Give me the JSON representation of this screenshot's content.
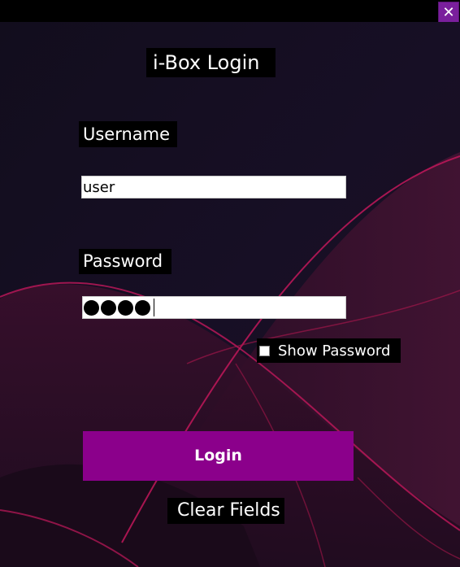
{
  "window": {
    "close_glyph": "✕"
  },
  "login": {
    "title": "i-Box Login",
    "username_label": "Username",
    "username_value": "user",
    "password_label": "Password",
    "password_dot_count": 4,
    "show_password_label": "Show Password",
    "show_password_checked": false,
    "login_button_label": "Login",
    "clear_button_label": "Clear Fields"
  },
  "colors": {
    "accent": "#8b008b",
    "close_button": "#7a1f9c",
    "background_dark": "#110c1f",
    "wave_red": "#c2185b"
  }
}
